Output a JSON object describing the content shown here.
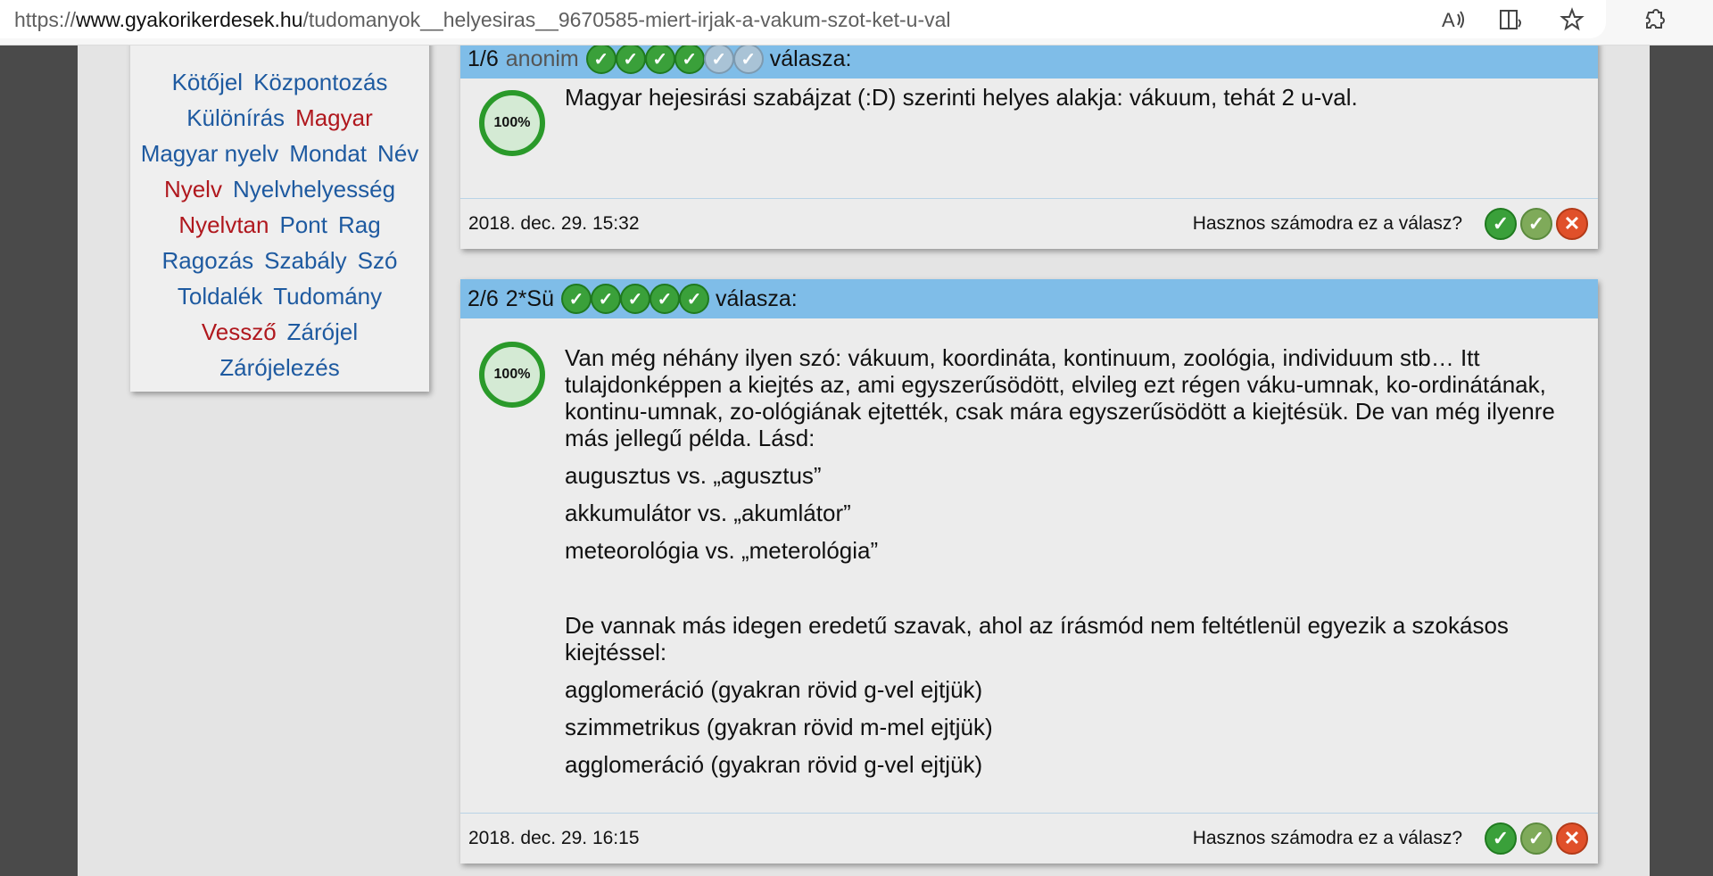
{
  "browser": {
    "url_prefix": "https://",
    "url_host": "www.gyakorikerdesek.hu",
    "url_path": "/tudomanyok__helyesiras__9670585-miert-irjak-a-vakum-szot-ket-u-val",
    "icons": [
      "read-aloud-icon",
      "immersive-reader-icon",
      "favorite-star-icon",
      "extensions-icon"
    ]
  },
  "tags": {
    "lines": [
      [
        {
          "text": "Kötőjel",
          "color": "blue"
        },
        {
          "text": "Központozás",
          "color": "blue"
        }
      ],
      [
        {
          "text": "Különírás",
          "color": "blue"
        },
        {
          "text": "Magyar",
          "color": "red"
        }
      ],
      [
        {
          "text": "Magyar nyelv",
          "color": "blue"
        },
        {
          "text": "Mondat",
          "color": "blue"
        },
        {
          "text": "Név",
          "color": "blue"
        }
      ],
      [
        {
          "text": "Nyelv",
          "color": "red"
        },
        {
          "text": "Nyelvhelyesség",
          "color": "blue"
        }
      ],
      [
        {
          "text": "Nyelvtan",
          "color": "red"
        },
        {
          "text": "Pont",
          "color": "blue"
        },
        {
          "text": "Rag",
          "color": "blue"
        }
      ],
      [
        {
          "text": "Ragozás",
          "color": "blue"
        },
        {
          "text": "Szabály",
          "color": "blue"
        },
        {
          "text": "Szó",
          "color": "blue"
        }
      ],
      [
        {
          "text": "Toldalék",
          "color": "blue"
        },
        {
          "text": "Tudomány",
          "color": "blue"
        }
      ],
      [
        {
          "text": "Vessző",
          "color": "red"
        },
        {
          "text": "Zárójel",
          "color": "blue"
        }
      ],
      [
        {
          "text": "Zárójelezés",
          "color": "blue"
        }
      ]
    ]
  },
  "answers": [
    {
      "index": "1/6",
      "author": "anonim",
      "rating_checks": 4,
      "rating_max": 6,
      "suffix": "válasza:",
      "percent": "100%",
      "paragraphs": [
        "Magyar hejesirási szabájzat (:D) szerinti helyes alakja: vákuum, tehát 2 u-val."
      ],
      "date": "2018. dec. 29. 15:32",
      "helpful_q": "Hasznos számodra ez a válasz?"
    },
    {
      "index": "2/6",
      "author": "2*Sü",
      "rating_checks": 5,
      "rating_max": 5,
      "suffix": "válasza:",
      "percent": "100%",
      "paragraphs": [
        "Van még néhány ilyen szó: vákuum, koordináta, kontinuum, zoológia, individuum stb… Itt tulajdonképpen a kiejtés az, ami egyszerűsödött, elvileg ezt régen váku-umnak, ko-ordinátának, kontinu-umnak, zo-ológiának ejtették, csak mára egyszerűsödött a kiejtésük. De van még ilyenre más jellegű példa. Lásd:",
        "augusztus vs. „agusztus”",
        "akkumulátor vs. „akumlátor”",
        "meteorológia vs. „meterológia”",
        "",
        "De vannak más idegen eredetű szavak, ahol az írásmód nem feltétlenül egyezik a szokásos kiejtéssel:",
        "agglomeráció (gyakran rövid g-vel ejtjük)",
        "szimmetrikus (gyakran rövid m-mel ejtjük)",
        "agglomeráció (gyakran rövid g-vel ejtjük)"
      ],
      "date": "2018. dec. 29. 16:15",
      "helpful_q": "Hasznos számodra ez a válasz?"
    }
  ],
  "colors": {
    "tag_blue": "#1e5aa0",
    "tag_red": "#b0181e",
    "header_bar": "#7fbde8",
    "check_green": "#3aa03a"
  }
}
